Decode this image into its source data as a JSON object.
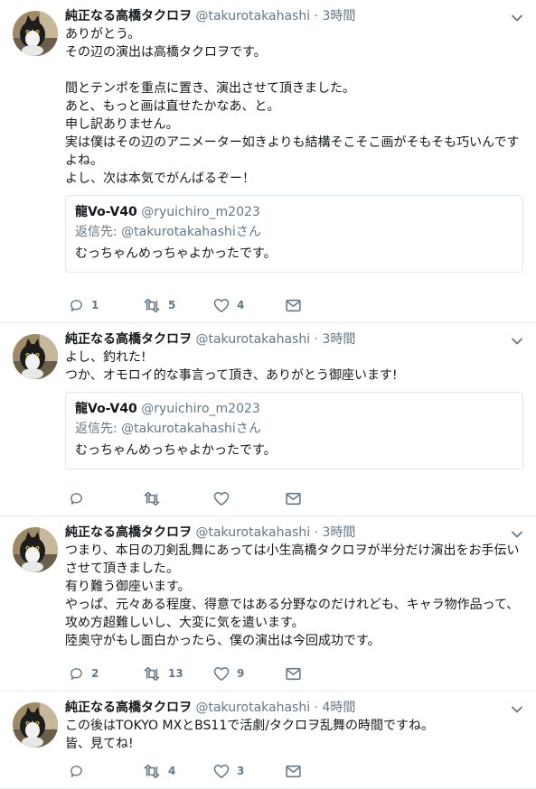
{
  "tweets": [
    {
      "name": "純正なる高橋タクロヲ",
      "handle": "@takurotakahashi",
      "dot": "·",
      "time": "3時間",
      "text": "ありがとう。\nその辺の演出は高橋タクロヲです。\n\n間とテンポを重点に置き、演出させて頂きました。\nあと、もっと画は直せたかなあ、と。\n申し訳ありません。\n実は僕はその辺のアニメーター如きよりも結構そこそこ画がそもそも巧いんです\nよね。\nよし、次は本気でがんばるぞー！",
      "quote": {
        "name": "龍Vo-V40",
        "handle": "@ryuichiro_m2023",
        "reply": "返信先: @takurotakahashiさん",
        "text": "むっちゃんめっちゃよかったです。"
      },
      "replies": "1",
      "retweets": "5",
      "likes": "4"
    },
    {
      "name": "純正なる高橋タクロヲ",
      "handle": "@takurotakahashi",
      "dot": "·",
      "time": "3時間",
      "text": "よし、釣れた!\nつか、オモロイ的な事言って頂き、ありがとう御座います!",
      "quote": {
        "name": "龍Vo-V40",
        "handle": "@ryuichiro_m2023",
        "reply": "返信先: @takurotakahashiさん",
        "text": "むっちゃんめっちゃよかったです。"
      },
      "replies": "",
      "retweets": "",
      "likes": ""
    },
    {
      "name": "純正なる高橋タクロヲ",
      "handle": "@takurotakahashi",
      "dot": "·",
      "time": "3時間",
      "text": "つまり、本日の刀剣乱舞にあっては小生高橋タクロヲが半分だけ演出をお手伝い\nさせて頂きました。\n有り難う御座います。\nやっぱ、元々ある程度、得意ではある分野なのだけれども、キャラ物作品って、\n攻め方超難しいし、大変に気を遣います。\n陸奥守がもし面白かったら、僕の演出は今回成功です。",
      "quote": null,
      "replies": "2",
      "retweets": "13",
      "likes": "9"
    },
    {
      "name": "純正なる高橋タクロヲ",
      "handle": "@takurotakahashi",
      "dot": "·",
      "time": "4時間",
      "text": "この後はTOKYO MXとBS11で活劇/タクロヲ乱舞の時間ですね。\n皆、見てね!",
      "quote": null,
      "replies": "",
      "retweets": "4",
      "likes": "3"
    }
  ],
  "colors": {
    "text": "#14171a",
    "secondary": "#657786",
    "border": "#e6ecf0"
  }
}
